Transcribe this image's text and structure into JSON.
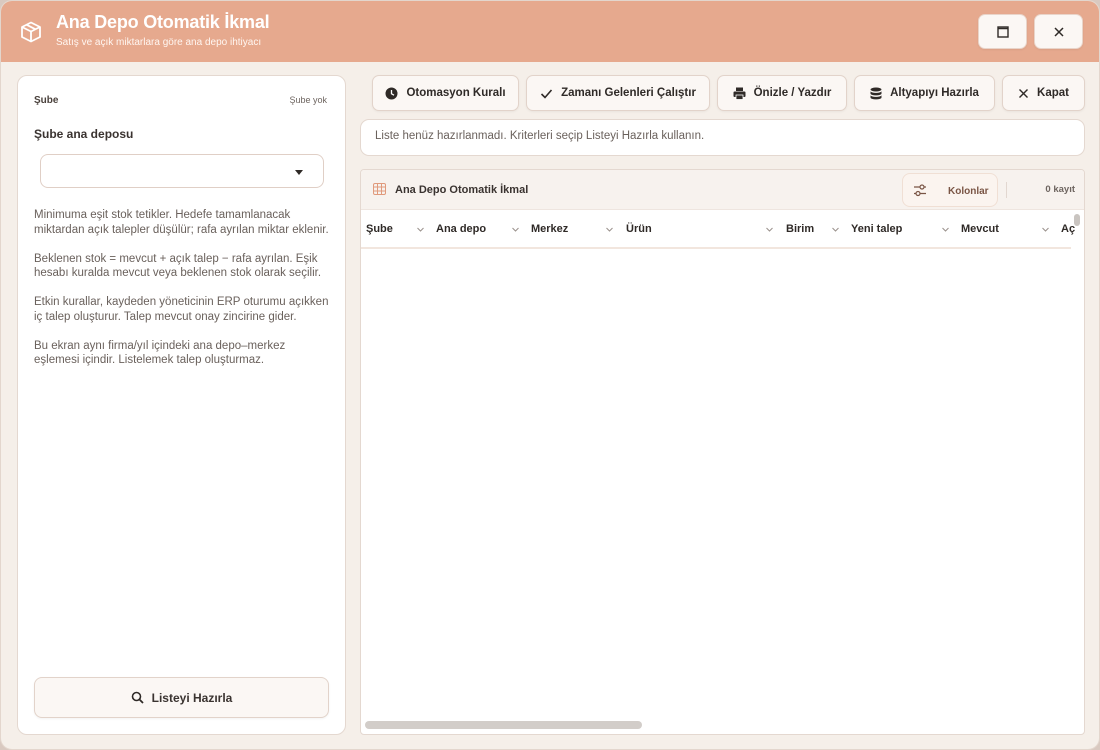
{
  "window": {
    "title": "Ana Depo Otomatik İkmal",
    "subtitle": "Satış ve açık miktarlara göre ana depo ihtiyacı",
    "accent_color": "#e6a98e",
    "maximize_icon": "maximize-icon",
    "close_icon": "close-icon"
  },
  "left_panel": {
    "branch_label": "Şube",
    "branch_value": "Şube yok",
    "depot_label": "Şube ana deposu",
    "depot_select_value": "",
    "info_paragraphs": [
      "Minimuma eşit stok tetikler. Hedefe tamamlanacak miktardan açık talepler düşülür; rafa ayrılan miktar eklenir.",
      "Beklenen stok = mevcut + açık talep − rafa ayrılan. Eşik hesabı kuralda mevcut veya beklenen stok olarak seçilir.",
      "Etkin kurallar, kaydeden yöneticinin ERP oturumu açıkken iç talep oluşturur. Talep mevcut onay zincirine gider.",
      "Bu ekran aynı firma/yıl içindeki ana depo–merkez eşlemesi içindir. Listelemek talep oluşturmaz."
    ],
    "prepare_button": "Listeyi Hazırla"
  },
  "toolbar": {
    "automation_rule": "Otomasyon Kuralı",
    "run_due": "Zamanı Gelenleri Çalıştır",
    "preview_print": "Önizle / Yazdır",
    "prepare_infra": "Altyapıyı Hazırla",
    "close": "Kapat"
  },
  "status": {
    "message": "Liste henüz hazırlanmadı. Kriterleri seçip Listeyi Hazırla kullanın."
  },
  "grid": {
    "title": "Ana Depo Otomatik İkmal",
    "columns_button": "Kolonlar",
    "record_count": "0 kayıt",
    "columns": [
      "Şube",
      "Ana depo",
      "Merkez",
      "Ürün",
      "Birim",
      "Yeni talep",
      "Mevcut",
      "Aç"
    ],
    "rows": []
  }
}
